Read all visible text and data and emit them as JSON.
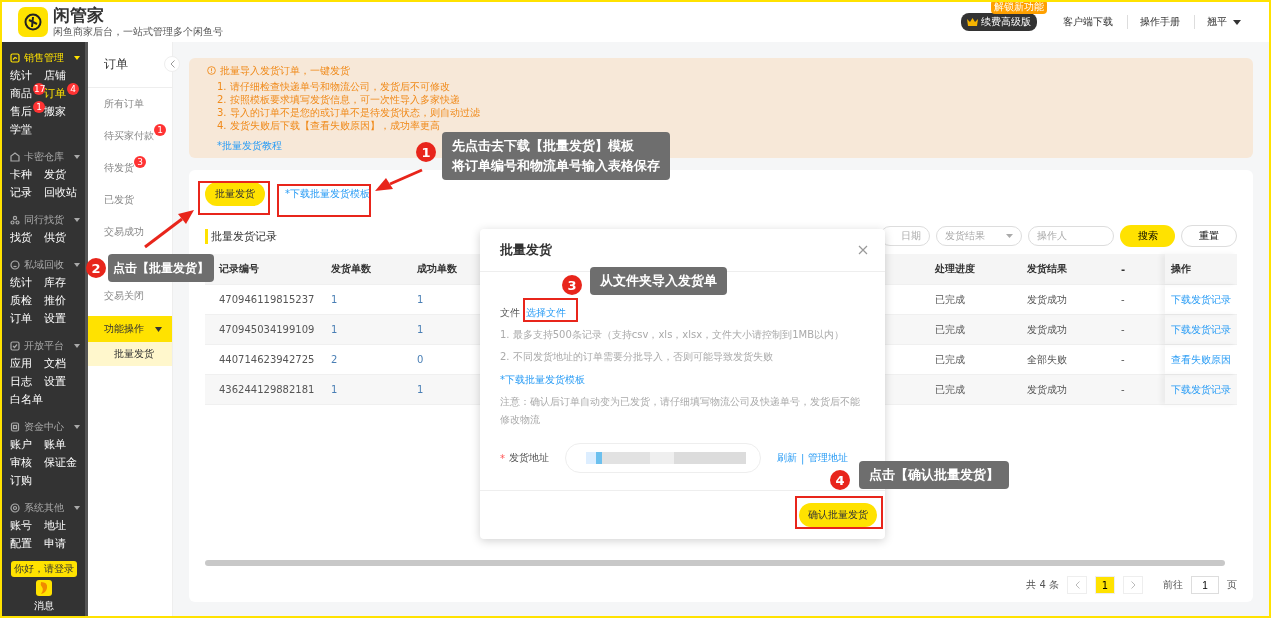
{
  "header": {
    "app_name": "闲管家",
    "tagline": "闲鱼商家后台，一站式管理多个闲鱼号",
    "new_badge": "解锁新功能",
    "upgrade_button": "续费高级版",
    "links": [
      "客户端下载",
      "操作手册"
    ],
    "user": "翘平"
  },
  "sidebar": {
    "groups": [
      {
        "title": "销售管理",
        "active": true,
        "items": [
          {
            "label": "统计",
            "selected": false
          },
          {
            "label": "店铺",
            "selected": false
          },
          {
            "label": "商品",
            "badge": "17",
            "selected": false
          },
          {
            "label": "订单",
            "badge": "4",
            "selected": true
          },
          {
            "label": "售后",
            "badge": "1",
            "selected": false
          },
          {
            "label": "搬家",
            "selected": false
          },
          {
            "label": "学堂",
            "selected": false
          }
        ]
      },
      {
        "title": "卡密仓库",
        "active": false,
        "items": [
          {
            "label": "卡种",
            "selected": false
          },
          {
            "label": "发货",
            "selected": false
          },
          {
            "label": "记录",
            "selected": false
          },
          {
            "label": "回收站",
            "selected": false
          }
        ]
      },
      {
        "title": "同行找货",
        "active": false,
        "items": [
          {
            "label": "找货",
            "selected": false
          },
          {
            "label": "供货",
            "selected": false
          }
        ]
      },
      {
        "title": "私域回收",
        "active": false,
        "items": [
          {
            "label": "统计",
            "selected": false
          },
          {
            "label": "库存",
            "selected": false
          },
          {
            "label": "质检",
            "selected": false
          },
          {
            "label": "推价",
            "selected": false
          },
          {
            "label": "订单",
            "selected": false
          },
          {
            "label": "设置",
            "selected": false
          }
        ]
      },
      {
        "title": "开放平台",
        "active": false,
        "items": [
          {
            "label": "应用",
            "selected": false
          },
          {
            "label": "文档",
            "selected": false
          },
          {
            "label": "日志",
            "selected": false
          },
          {
            "label": "设置",
            "selected": false
          },
          {
            "label": "白名单",
            "selected": false
          }
        ]
      },
      {
        "title": "资金中心",
        "active": false,
        "items": [
          {
            "label": "账户",
            "selected": false
          },
          {
            "label": "账单",
            "selected": false
          },
          {
            "label": "审核",
            "selected": false
          },
          {
            "label": "保证金",
            "selected": false
          },
          {
            "label": "订购",
            "selected": false
          }
        ]
      },
      {
        "title": "系统其他",
        "active": false,
        "items": [
          {
            "label": "账号",
            "selected": false
          },
          {
            "label": "地址",
            "selected": false
          },
          {
            "label": "配置",
            "selected": false
          },
          {
            "label": "申请",
            "selected": false
          }
        ]
      }
    ],
    "login_tip": "你好，请登录",
    "message_label": "消息"
  },
  "subnav": {
    "title": "订单",
    "items": [
      {
        "label": "所有订单",
        "selected": false
      },
      {
        "label": "待买家付款",
        "badge": "1",
        "selected": false
      },
      {
        "label": "待发货",
        "badge": "3",
        "selected": false
      },
      {
        "label": "已发货",
        "selected": false
      },
      {
        "label": "交易成功",
        "selected": false
      },
      {
        "label": "交易关闭",
        "selected": false
      }
    ],
    "section": {
      "label": "功能操作",
      "expanded": true,
      "items": [
        {
          "label": "批量发货",
          "selected": true
        }
      ]
    }
  },
  "notice": {
    "title": "批量导入发货订单，一键发货",
    "lines": [
      "1. 请仔细检查快递单号和物流公司，发货后不可修改",
      "2. 按照模板要求填写发货信息，可一次性导入多家快递",
      "3. 导入的订单不是您的或订单不是待发货状态，则自动过滤",
      "4. 发货失败后下载【查看失败原因】，成功率更高"
    ],
    "link": "*批量发货教程"
  },
  "records": {
    "batch_button": "批量发货",
    "template_link": "*下载批量发货模板",
    "title": "批量发货记录",
    "filters": [
      {
        "kind": "date",
        "placeholder": "日期"
      },
      {
        "kind": "select",
        "placeholder": "发货结果"
      },
      {
        "kind": "text",
        "placeholder": "操作人"
      }
    ],
    "search_button": "搜索",
    "reset_button": "重置",
    "columns": [
      "记录编号",
      "发货单数",
      "成功单数",
      "处理进度",
      "发货结果",
      "-",
      "操作"
    ],
    "rows": [
      {
        "cells": [
          "470946119815237",
          "1",
          "1",
          "已完成",
          "发货成功",
          "-"
        ],
        "action": "下载发货记录"
      },
      {
        "cells": [
          "470945034199109",
          "1",
          "1",
          "已完成",
          "发货成功",
          "-"
        ],
        "action": "下载发货记录"
      },
      {
        "cells": [
          "440714623942725",
          "2",
          "0",
          "已完成",
          "全部失败",
          "-"
        ],
        "action": "查看失败原因"
      },
      {
        "cells": [
          "436244129882181",
          "1",
          "1",
          "已完成",
          "发货成功",
          "-"
        ],
        "action": "下载发货记录"
      }
    ],
    "pagination": {
      "total": "共 4 条",
      "pages": [
        {
          "label": "1",
          "selected": true
        }
      ],
      "goto_label": "前往",
      "goto_value": "1",
      "page_suffix": "页"
    }
  },
  "modal": {
    "title": "批量发货",
    "file_label": "文件",
    "choose_file": "选择文件",
    "notes": [
      "1. 最多支持500条记录（支持csv，xls，xlsx，文件大小请控制到1MB以内）",
      "2. 不同发货地址的订单需要分批导入，否则可能导致发货失败"
    ],
    "template_link": "*下载批量发货模板",
    "warning": "注意：确认后订单自动变为已发货，请仔细填写物流公司及快递单号，发货后不能修改物流",
    "required_mark": "*",
    "address_label": "发货地址",
    "refresh_link": "刷新",
    "separator": "|",
    "manage_link": "管理地址",
    "confirm_button": "确认批量发货"
  },
  "annotations": [
    {
      "number": "1",
      "lines": [
        "先点击去下载【批量发货】模板",
        "将订单编号和物流单号输入表格保存"
      ]
    },
    {
      "number": "2",
      "lines": [
        "点击【批量发货】"
      ]
    },
    {
      "number": "3",
      "lines": [
        "从文件夹导入发货单"
      ]
    },
    {
      "number": "4",
      "lines": [
        "点击【确认批量发货】"
      ]
    }
  ]
}
